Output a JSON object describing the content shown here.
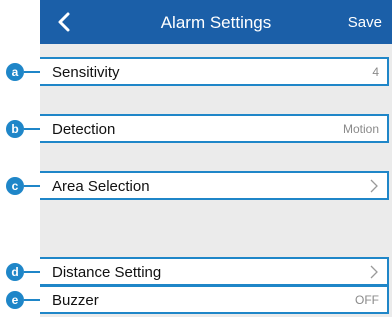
{
  "navbar": {
    "title": "Alarm Settings",
    "save_label": "Save"
  },
  "colors": {
    "header": "#1b5fa8",
    "accent": "#1f86c8",
    "list_background": "#ebebeb"
  },
  "rows": [
    {
      "badge": "a",
      "label": "Sensitivity",
      "value": "4"
    },
    {
      "badge": "b",
      "label": "Detection",
      "value": "Motion"
    },
    {
      "badge": "c",
      "label": "Area Selection",
      "icon": "chevron-right-icon"
    },
    {
      "badge": "d",
      "label": "Distance Setting",
      "icon": "chevron-right-icon"
    },
    {
      "badge": "e",
      "label": "Buzzer",
      "value": "OFF"
    }
  ]
}
